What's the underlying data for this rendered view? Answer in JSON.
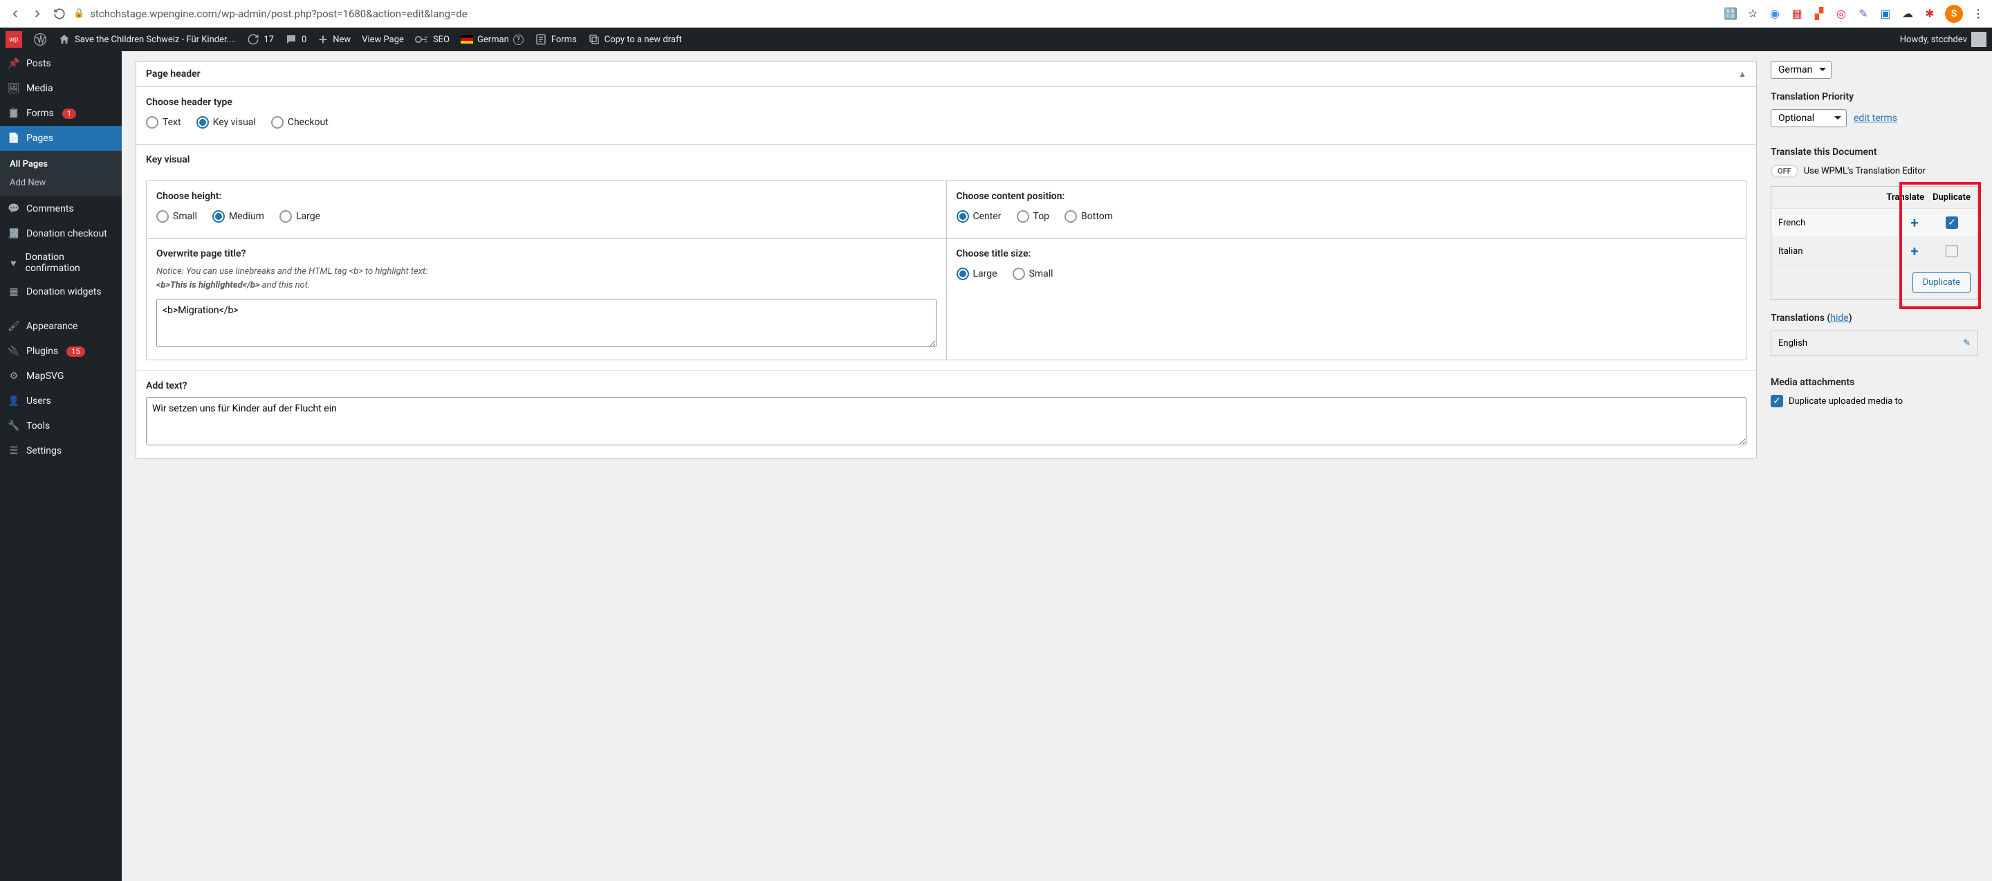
{
  "browser": {
    "url": "stchchstage.wpengine.com/wp-admin/post.php?post=1680&action=edit&lang=de",
    "avatar_letter": "S"
  },
  "adminbar": {
    "site_title": "Save the Children Schweiz - Für Kinder....",
    "updates_count": "17",
    "comments_count": "0",
    "new_label": "New",
    "view_page": "View Page",
    "seo": "SEO",
    "language": "German",
    "forms": "Forms",
    "copy": "Copy to a new draft",
    "howdy": "Howdy, stcchdev"
  },
  "sidebar": {
    "posts": "Posts",
    "media": "Media",
    "forms": "Forms",
    "forms_badge": "1",
    "pages": "Pages",
    "all_pages": "All Pages",
    "add_new": "Add New",
    "comments": "Comments",
    "donation_checkout": "Donation checkout",
    "donation_confirmation": "Donation confirmation",
    "donation_widgets": "Donation widgets",
    "appearance": "Appearance",
    "plugins": "Plugins",
    "plugins_badge": "15",
    "mapsvg": "MapSVG",
    "users": "Users",
    "tools": "Tools",
    "settings": "Settings"
  },
  "main": {
    "page_header_title": "Page header",
    "choose_header_type": "Choose header type",
    "header_types": {
      "text": "Text",
      "key_visual": "Key visual",
      "checkout": "Checkout"
    },
    "key_visual_title": "Key visual",
    "choose_height": "Choose height:",
    "heights": {
      "small": "Small",
      "medium": "Medium",
      "large": "Large"
    },
    "choose_content_position": "Choose content position:",
    "positions": {
      "center": "Center",
      "top": "Top",
      "bottom": "Bottom"
    },
    "overwrite_title": "Overwrite page title?",
    "overwrite_notice_1": "Notice: You can use linebreaks and the HTML tag <b> to highlight text:",
    "overwrite_notice_2": "<b>This is highlighted</b>",
    "overwrite_notice_3": " and this not.",
    "overwrite_value": "<b>Migration</b>",
    "choose_title_size": "Choose title size:",
    "title_sizes": {
      "large": "Large",
      "small": "Small"
    },
    "add_text": "Add text?",
    "add_text_value": "Wir setzen uns für Kinder auf der Flucht ein"
  },
  "side": {
    "language_select": "German",
    "translation_priority": "Translation Priority",
    "priority_value": "Optional",
    "edit_terms": "edit terms",
    "translate_doc": "Translate this Document",
    "toggle_off": "OFF",
    "use_wpml": "Use WPML's Translation Editor",
    "th_translate": "Translate",
    "th_duplicate": "Duplicate",
    "lang_french": "French",
    "lang_italian": "Italian",
    "duplicate_btn": "Duplicate",
    "translations_heading": "Translations",
    "hide": "hide",
    "english": "English",
    "media_attachments": "Media attachments",
    "dup_media": "Duplicate uploaded media to"
  }
}
